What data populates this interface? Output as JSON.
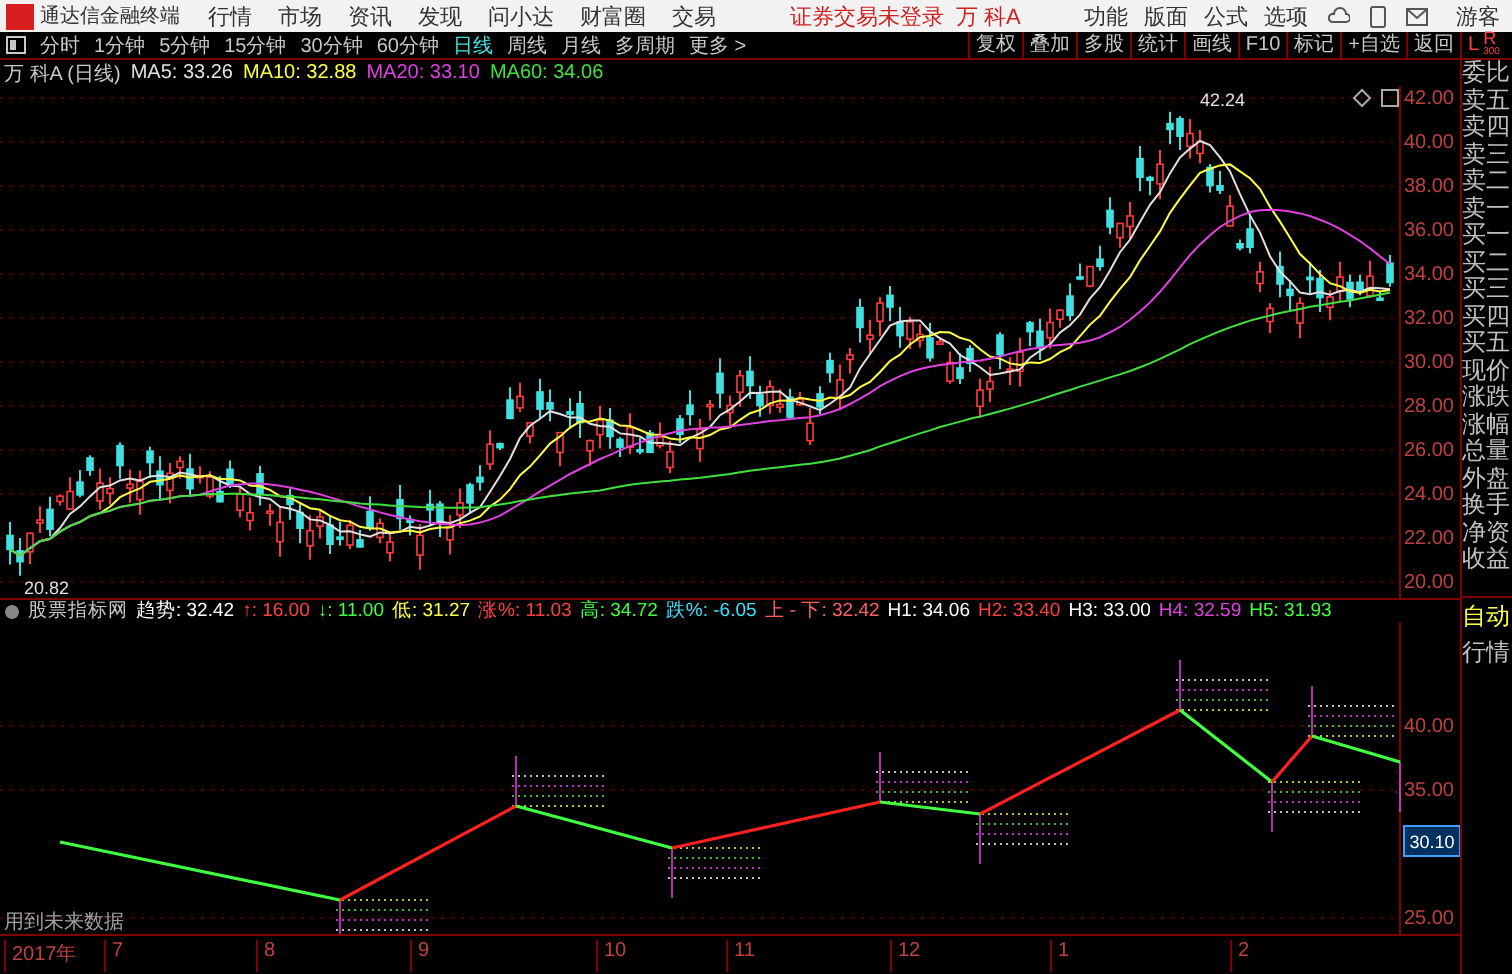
{
  "app": {
    "title": "通达信金融终端"
  },
  "menu": [
    "行情",
    "市场",
    "资讯",
    "发现",
    "问小达",
    "财富圈",
    "交易"
  ],
  "login_status": "证券交易未登录",
  "stock_name": "万 科A",
  "top_links": [
    "功能",
    "版面",
    "公式",
    "选项"
  ],
  "user": "游客",
  "periods": [
    {
      "label": "分时",
      "selected": false
    },
    {
      "label": "1分钟",
      "selected": false
    },
    {
      "label": "5分钟",
      "selected": false
    },
    {
      "label": "15分钟",
      "selected": false
    },
    {
      "label": "30分钟",
      "selected": false
    },
    {
      "label": "60分钟",
      "selected": false
    },
    {
      "label": "日线",
      "selected": true
    },
    {
      "label": "周线",
      "selected": false
    },
    {
      "label": "月线",
      "selected": false
    },
    {
      "label": "多周期",
      "selected": false
    },
    {
      "label": "更多 >",
      "selected": false
    }
  ],
  "tools": [
    "复权",
    "叠加",
    "多股",
    "统计",
    "画线",
    "F10",
    "标记",
    "+自选",
    "返回"
  ],
  "corner": {
    "left": "L",
    "right": "R",
    "sub": "300"
  },
  "chart_header": {
    "title": "万 科A (日线)",
    "ma": [
      {
        "label": "MA5: 33.26",
        "color": "#e0e0e0"
      },
      {
        "label": "MA10: 32.88",
        "color": "#ffff40"
      },
      {
        "label": "MA20: 33.10",
        "color": "#e040e0"
      },
      {
        "label": "MA60: 34.06",
        "color": "#40e040"
      }
    ]
  },
  "price_axis": [
    "42.00",
    "40.00",
    "38.00",
    "36.00",
    "34.00",
    "32.00",
    "30.00",
    "28.00",
    "26.00",
    "24.00",
    "22.00",
    "20.00"
  ],
  "high_marker": "42.24",
  "low_marker": "20.82",
  "indicator": {
    "name": "股票指标网",
    "values": [
      {
        "label": "趋势: 32.42",
        "color": "#ffffff"
      },
      {
        "label": "↑: 16.00",
        "color": "#ff4040"
      },
      {
        "label": "↓: 11.00",
        "color": "#40ff40"
      },
      {
        "label": "低: 31.27",
        "color": "#ffff40"
      },
      {
        "label": "涨%: 11.03",
        "color": "#ff4040"
      },
      {
        "label": "高: 34.72",
        "color": "#40ff40"
      },
      {
        "label": "跌%: -6.05",
        "color": "#40e0ff"
      },
      {
        "label": "上 - 下: 32.42",
        "color": "#ff6060"
      },
      {
        "label": "H1: 34.06",
        "color": "#ffffff"
      },
      {
        "label": "H2: 33.40",
        "color": "#ff4040"
      },
      {
        "label": "H3: 33.00",
        "color": "#ffffff"
      },
      {
        "label": "H4: 32.59",
        "color": "#e040e0"
      },
      {
        "label": "H5: 31.93",
        "color": "#40ff40"
      }
    ]
  },
  "indicator_axis": [
    "40.00",
    "35.00",
    "25.00"
  ],
  "indicator_current": "30.10",
  "note": "用到未来数据",
  "date_axis": [
    "2017年",
    "7",
    "8",
    "9",
    "10",
    "11",
    "12",
    "1",
    "2"
  ],
  "side_labels": [
    "委比",
    "卖五",
    "卖四",
    "卖三",
    "卖二",
    "卖一",
    "买一",
    "买二",
    "买三",
    "买四",
    "买五",
    "现价",
    "涨跌",
    "涨幅",
    "总量",
    "外盘",
    "换手",
    "净资",
    "收益"
  ],
  "side_lower": [
    "自动",
    "行情"
  ]
}
